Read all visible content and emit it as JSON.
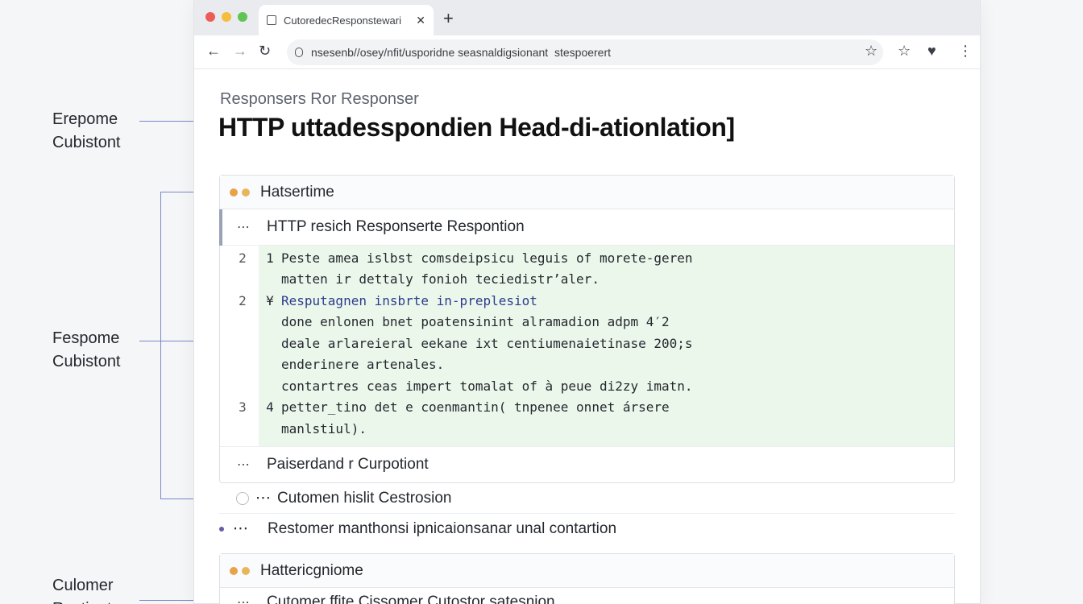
{
  "annotations": [
    {
      "line1": "Erepome",
      "line2": "Cubistont"
    },
    {
      "line1": "Fespome",
      "line2": "Cubistont"
    },
    {
      "line1": "Culomer",
      "line2": "Rectiont"
    }
  ],
  "browser": {
    "tab_title": "CutoredecResponstewari",
    "tab_close": "✕",
    "new_tab": "+",
    "url": "nsesenb//osey/nfit/usporidne seasnaldigsionant  stespoerert"
  },
  "page": {
    "subheading": "Responsers Ror Responser",
    "title": "HTTP uttadesspondien Head-di-ationlation]"
  },
  "panel1": {
    "header": "Hatsertime",
    "row1": "HTTP resich Responserte Respontion",
    "code_lines": [
      {
        "num": "2",
        "mark": "1",
        "text": "Peste amea islbst comsdeipsicu leguis of morete-geren"
      },
      {
        "num": "",
        "mark": "",
        "text": "matten ir dettaly fonioh teciedistr’aler."
      },
      {
        "num": "2",
        "mark": "¥",
        "text": "Resputagnen insbrte in-preplesiot",
        "style": "blue"
      },
      {
        "num": "",
        "mark": "",
        "text": "done enlonen bnet poatensinint alramadion adpm 4′2"
      },
      {
        "num": "",
        "mark": "",
        "text": "deale arlareieral eekane ixt centiumenaietinase 200;s"
      },
      {
        "num": "",
        "mark": "",
        "text": "enderinere artenales."
      },
      {
        "num": "",
        "mark": "",
        "text": "contartres ceas impert tomalat of à peue di2zy imatn."
      },
      {
        "num": "3",
        "mark": "4",
        "text": "petter_tino det e coenmantin( tnpenee onnet ársere"
      },
      {
        "num": "",
        "mark": "",
        "text": "manlstiul)."
      }
    ],
    "row2": "Paiserdand r Curpotiont"
  },
  "list": {
    "item1": "Cutomen hislit Cestrosion",
    "item2": "Restomer manthonsi ipnicaionsanar unal contartion"
  },
  "panel2": {
    "header": "Hattericgniome",
    "row1": "Cutomer ffite Cissomer Cutostor satesnion"
  },
  "common": {
    "dots": "⋯"
  },
  "colors": {
    "accent_line": "#7a86c9",
    "code_bg": "#ecf7ec",
    "orange_dot": "#e8a24a",
    "gold_dot": "#d9b25a"
  }
}
